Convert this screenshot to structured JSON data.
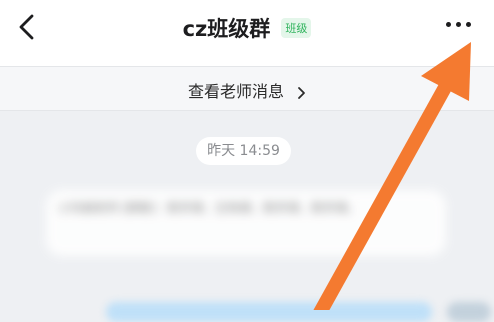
{
  "header": {
    "back_icon": "back-chevron-icon",
    "title": "cz班级群",
    "badge": "班级",
    "more_icon": "more-dots-icon"
  },
  "teacher_bar": {
    "label": "查看老师消息",
    "chevron_icon": "chevron-right-icon"
  },
  "chat": {
    "time_label": "昨天 14:59",
    "blurred_message": "小玛姆老师 [群聊]：数学课，生物课，数学课，数学课。"
  },
  "colors": {
    "header_bg": "#ffffff",
    "chat_bg": "#eef0f3",
    "badge_green": "#2fb35c",
    "annotation_arrow": "#f47a30"
  }
}
